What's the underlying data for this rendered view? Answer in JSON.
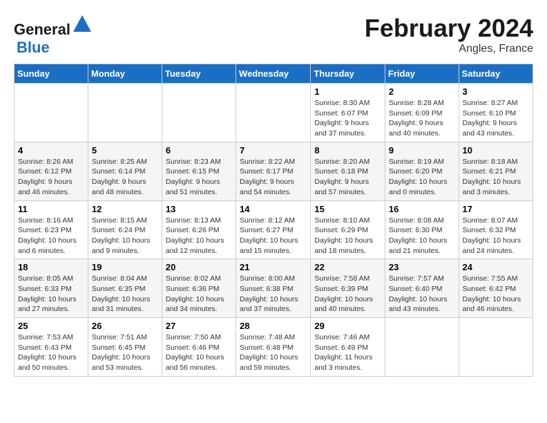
{
  "logo": {
    "text_general": "General",
    "text_blue": "Blue"
  },
  "header": {
    "month_year": "February 2024",
    "location": "Angles, France"
  },
  "weekdays": [
    "Sunday",
    "Monday",
    "Tuesday",
    "Wednesday",
    "Thursday",
    "Friday",
    "Saturday"
  ],
  "weeks": [
    [
      {
        "day": "",
        "info": ""
      },
      {
        "day": "",
        "info": ""
      },
      {
        "day": "",
        "info": ""
      },
      {
        "day": "",
        "info": ""
      },
      {
        "day": "1",
        "info": "Sunrise: 8:30 AM\nSunset: 6:07 PM\nDaylight: 9 hours and 37 minutes."
      },
      {
        "day": "2",
        "info": "Sunrise: 8:28 AM\nSunset: 6:09 PM\nDaylight: 9 hours and 40 minutes."
      },
      {
        "day": "3",
        "info": "Sunrise: 8:27 AM\nSunset: 6:10 PM\nDaylight: 9 hours and 43 minutes."
      }
    ],
    [
      {
        "day": "4",
        "info": "Sunrise: 8:26 AM\nSunset: 6:12 PM\nDaylight: 9 hours and 46 minutes."
      },
      {
        "day": "5",
        "info": "Sunrise: 8:25 AM\nSunset: 6:14 PM\nDaylight: 9 hours and 48 minutes."
      },
      {
        "day": "6",
        "info": "Sunrise: 8:23 AM\nSunset: 6:15 PM\nDaylight: 9 hours and 51 minutes."
      },
      {
        "day": "7",
        "info": "Sunrise: 8:22 AM\nSunset: 6:17 PM\nDaylight: 9 hours and 54 minutes."
      },
      {
        "day": "8",
        "info": "Sunrise: 8:20 AM\nSunset: 6:18 PM\nDaylight: 9 hours and 57 minutes."
      },
      {
        "day": "9",
        "info": "Sunrise: 8:19 AM\nSunset: 6:20 PM\nDaylight: 10 hours and 0 minutes."
      },
      {
        "day": "10",
        "info": "Sunrise: 8:18 AM\nSunset: 6:21 PM\nDaylight: 10 hours and 3 minutes."
      }
    ],
    [
      {
        "day": "11",
        "info": "Sunrise: 8:16 AM\nSunset: 6:23 PM\nDaylight: 10 hours and 6 minutes."
      },
      {
        "day": "12",
        "info": "Sunrise: 8:15 AM\nSunset: 6:24 PM\nDaylight: 10 hours and 9 minutes."
      },
      {
        "day": "13",
        "info": "Sunrise: 8:13 AM\nSunset: 6:26 PM\nDaylight: 10 hours and 12 minutes."
      },
      {
        "day": "14",
        "info": "Sunrise: 8:12 AM\nSunset: 6:27 PM\nDaylight: 10 hours and 15 minutes."
      },
      {
        "day": "15",
        "info": "Sunrise: 8:10 AM\nSunset: 6:29 PM\nDaylight: 10 hours and 18 minutes."
      },
      {
        "day": "16",
        "info": "Sunrise: 8:08 AM\nSunset: 6:30 PM\nDaylight: 10 hours and 21 minutes."
      },
      {
        "day": "17",
        "info": "Sunrise: 8:07 AM\nSunset: 6:32 PM\nDaylight: 10 hours and 24 minutes."
      }
    ],
    [
      {
        "day": "18",
        "info": "Sunrise: 8:05 AM\nSunset: 6:33 PM\nDaylight: 10 hours and 27 minutes."
      },
      {
        "day": "19",
        "info": "Sunrise: 8:04 AM\nSunset: 6:35 PM\nDaylight: 10 hours and 31 minutes."
      },
      {
        "day": "20",
        "info": "Sunrise: 8:02 AM\nSunset: 6:36 PM\nDaylight: 10 hours and 34 minutes."
      },
      {
        "day": "21",
        "info": "Sunrise: 8:00 AM\nSunset: 6:38 PM\nDaylight: 10 hours and 37 minutes."
      },
      {
        "day": "22",
        "info": "Sunrise: 7:58 AM\nSunset: 6:39 PM\nDaylight: 10 hours and 40 minutes."
      },
      {
        "day": "23",
        "info": "Sunrise: 7:57 AM\nSunset: 6:40 PM\nDaylight: 10 hours and 43 minutes."
      },
      {
        "day": "24",
        "info": "Sunrise: 7:55 AM\nSunset: 6:42 PM\nDaylight: 10 hours and 46 minutes."
      }
    ],
    [
      {
        "day": "25",
        "info": "Sunrise: 7:53 AM\nSunset: 6:43 PM\nDaylight: 10 hours and 50 minutes."
      },
      {
        "day": "26",
        "info": "Sunrise: 7:51 AM\nSunset: 6:45 PM\nDaylight: 10 hours and 53 minutes."
      },
      {
        "day": "27",
        "info": "Sunrise: 7:50 AM\nSunset: 6:46 PM\nDaylight: 10 hours and 56 minutes."
      },
      {
        "day": "28",
        "info": "Sunrise: 7:48 AM\nSunset: 6:48 PM\nDaylight: 10 hours and 59 minutes."
      },
      {
        "day": "29",
        "info": "Sunrise: 7:46 AM\nSunset: 6:49 PM\nDaylight: 11 hours and 3 minutes."
      },
      {
        "day": "",
        "info": ""
      },
      {
        "day": "",
        "info": ""
      }
    ]
  ]
}
